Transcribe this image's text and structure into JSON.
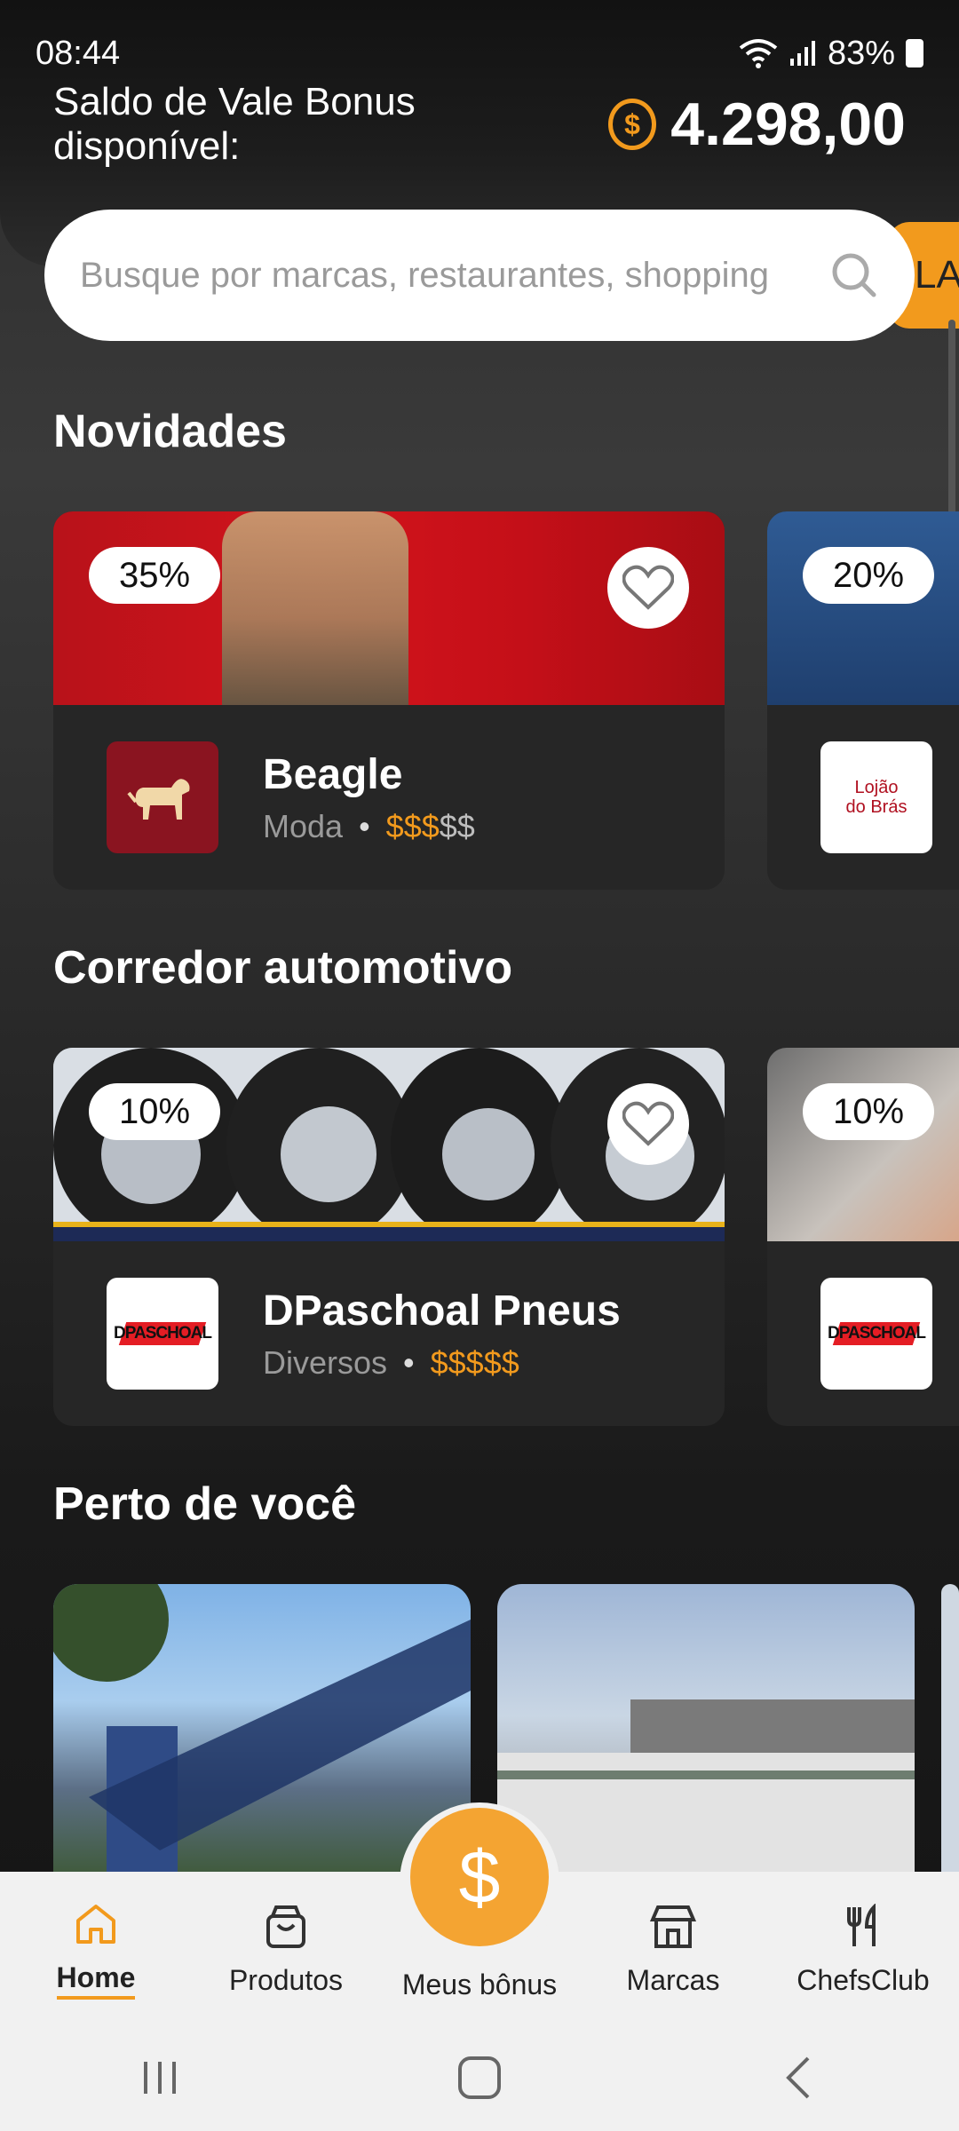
{
  "status": {
    "time": "08:44",
    "battery": "83%"
  },
  "balance": {
    "label": "Saldo de Vale Bonus disponível:",
    "currency_symbol": "$",
    "value": "4.298,00"
  },
  "search": {
    "placeholder": "Busque por marcas, restaurantes, shopping",
    "side_tab": "LAR"
  },
  "sections": {
    "news": {
      "title": "Novidades"
    },
    "auto": {
      "title": "Corredor automotivo"
    },
    "near": {
      "title": "Perto de você"
    }
  },
  "news_cards": [
    {
      "discount": "35%",
      "brand": "Beagle",
      "category": "Moda",
      "price_on": "$$$",
      "price_off": "$$"
    },
    {
      "discount": "20%",
      "logo_text_1": "Lojão",
      "logo_text_2": "do Brás"
    }
  ],
  "auto_cards": [
    {
      "discount": "10%",
      "brand": "DPaschoal Pneus",
      "category": "Diversos",
      "price_on": "$$$$$",
      "price_off": "",
      "logo_text": "DPASCHOAL"
    },
    {
      "discount": "10%",
      "logo_text": "DPASCHOAL"
    }
  ],
  "fab": {
    "symbol": "$"
  },
  "bottom_nav": [
    {
      "label": "Home",
      "icon": "home-icon"
    },
    {
      "label": "Produtos",
      "icon": "bag-icon"
    },
    {
      "label": "Meus bônus",
      "icon": "dollar-icon"
    },
    {
      "label": "Marcas",
      "icon": "store-icon"
    },
    {
      "label": "ChefsClub",
      "icon": "cutlery-icon"
    }
  ],
  "colors": {
    "accent": "#f29a1d",
    "card": "#262626",
    "nav_bg": "#f1f1f1"
  }
}
